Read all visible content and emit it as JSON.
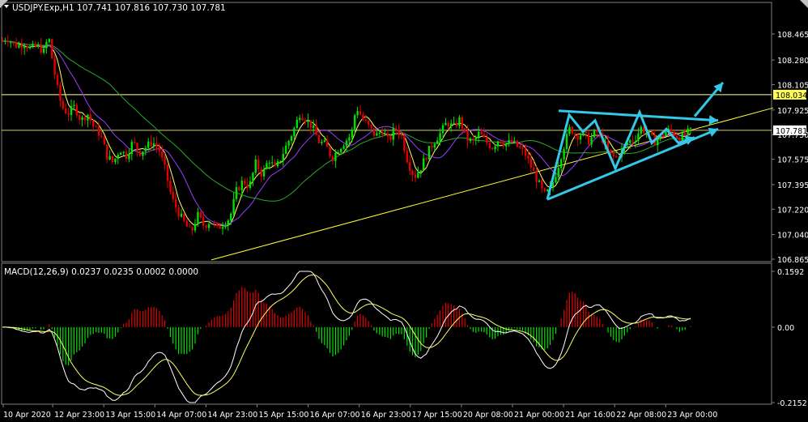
{
  "header": {
    "title": "USDJPY.Exp,H1  107.741 107.816 107.730 107.781",
    "menu_icon": "triangle-down-icon"
  },
  "colors": {
    "background": "#000000",
    "grid": "#6b6b6b",
    "bull": "#00e100",
    "bear": "#e10000",
    "ma_fast": "#ffff66",
    "ma_mid": "#9a3cff",
    "ma_slow": "#2aaa2a",
    "trend": "#ffff33",
    "pattern": "#33c8e6",
    "level_line": "#ffff99",
    "price_tag_bg": "#ffff55",
    "price_tag_current_bg": "#ffffff"
  },
  "price_axis": {
    "ticks": [
      "108.465",
      "108.280",
      "108.105",
      "107.925",
      "107.750",
      "107.575",
      "107.395",
      "107.220",
      "107.040",
      "106.865"
    ],
    "tags": [
      {
        "label": "108.034",
        "value": 108.034,
        "style": "level"
      },
      {
        "label": "107.781",
        "value": 107.781,
        "style": "current"
      }
    ]
  },
  "macd_panel": {
    "title": "MACD(12,26,9) 0.0237 0.0235 0.0002 0.0000",
    "ticks": [
      "0.1592",
      "0.00",
      "-0.2152"
    ]
  },
  "time_axis": {
    "labels": [
      "10 Apr 2020",
      "12 Apr 23:00",
      "13 Apr 15:00",
      "14 Apr 07:00",
      "14 Apr 23:00",
      "15 Apr 15:00",
      "16 Apr 07:00",
      "16 Apr 23:00",
      "17 Apr 15:00",
      "20 Apr 08:00",
      "21 Apr 00:00",
      "21 Apr 16:00",
      "22 Apr 08:00",
      "23 Apr 00:00"
    ]
  },
  "chart_data": {
    "type": "candlestick",
    "symbol": "USDJPY.Exp",
    "timeframe": "H1",
    "ohlc": [
      107.741,
      107.816,
      107.73,
      107.781
    ],
    "ylim": [
      106.865,
      108.58
    ],
    "horizontal_levels": [
      108.034,
      107.781
    ],
    "close_path": [
      [
        0,
        108.4
      ],
      [
        8,
        108.44
      ],
      [
        15,
        108.4
      ],
      [
        22,
        108.38
      ],
      [
        30,
        108.4
      ],
      [
        38,
        108.36
      ],
      [
        46,
        108.38
      ],
      [
        54,
        108.34
      ],
      [
        60,
        108.45
      ],
      [
        64,
        108.3
      ],
      [
        70,
        108.1
      ],
      [
        76,
        107.95
      ],
      [
        84,
        107.9
      ],
      [
        92,
        107.95
      ],
      [
        100,
        107.85
      ],
      [
        108,
        107.9
      ],
      [
        116,
        107.8
      ],
      [
        124,
        107.75
      ],
      [
        132,
        107.6
      ],
      [
        140,
        107.55
      ],
      [
        148,
        107.65
      ],
      [
        156,
        107.6
      ],
      [
        164,
        107.7
      ],
      [
        172,
        107.62
      ],
      [
        180,
        107.66
      ],
      [
        188,
        107.7
      ],
      [
        196,
        107.65
      ],
      [
        204,
        107.5
      ],
      [
        212,
        107.3
      ],
      [
        220,
        107.2
      ],
      [
        228,
        107.12
      ],
      [
        236,
        107.05
      ],
      [
        244,
        107.18
      ],
      [
        252,
        107.1
      ],
      [
        260,
        107.14
      ],
      [
        268,
        107.08
      ],
      [
        276,
        107.12
      ],
      [
        284,
        107.16
      ],
      [
        292,
        107.35
      ],
      [
        300,
        107.42
      ],
      [
        308,
        107.38
      ],
      [
        316,
        107.55
      ],
      [
        324,
        107.46
      ],
      [
        332,
        107.58
      ],
      [
        340,
        107.5
      ],
      [
        348,
        107.6
      ],
      [
        356,
        107.7
      ],
      [
        364,
        107.8
      ],
      [
        370,
        107.9
      ],
      [
        378,
        107.86
      ],
      [
        386,
        107.8
      ],
      [
        394,
        107.7
      ],
      [
        402,
        107.68
      ],
      [
        410,
        107.58
      ],
      [
        418,
        107.65
      ],
      [
        426,
        107.7
      ],
      [
        434,
        107.75
      ],
      [
        440,
        107.95
      ],
      [
        448,
        107.86
      ],
      [
        456,
        107.8
      ],
      [
        464,
        107.74
      ],
      [
        472,
        107.78
      ],
      [
        480,
        107.7
      ],
      [
        488,
        107.8
      ],
      [
        496,
        107.74
      ],
      [
        504,
        107.55
      ],
      [
        512,
        107.45
      ],
      [
        520,
        107.52
      ],
      [
        528,
        107.62
      ],
      [
        536,
        107.7
      ],
      [
        544,
        107.76
      ],
      [
        552,
        107.84
      ],
      [
        560,
        107.8
      ],
      [
        568,
        107.86
      ],
      [
        576,
        107.72
      ],
      [
        584,
        107.7
      ],
      [
        592,
        107.76
      ],
      [
        600,
        107.7
      ],
      [
        608,
        107.66
      ],
      [
        616,
        107.72
      ],
      [
        624,
        107.68
      ],
      [
        632,
        107.7
      ],
      [
        640,
        107.66
      ],
      [
        648,
        107.62
      ],
      [
        656,
        107.52
      ],
      [
        664,
        107.42
      ],
      [
        672,
        107.32
      ],
      [
        680,
        107.36
      ],
      [
        688,
        107.5
      ],
      [
        696,
        107.66
      ],
      [
        704,
        107.8
      ],
      [
        712,
        107.74
      ],
      [
        720,
        107.76
      ],
      [
        728,
        107.7
      ],
      [
        736,
        107.78
      ],
      [
        744,
        107.72
      ],
      [
        752,
        107.62
      ],
      [
        760,
        107.58
      ],
      [
        768,
        107.64
      ],
      [
        776,
        107.7
      ],
      [
        784,
        107.72
      ],
      [
        792,
        107.8
      ],
      [
        800,
        107.76
      ],
      [
        808,
        107.7
      ],
      [
        816,
        107.74
      ],
      [
        824,
        107.78
      ],
      [
        832,
        107.76
      ],
      [
        840,
        107.72
      ],
      [
        848,
        107.76
      ],
      [
        856,
        107.78
      ]
    ],
    "lines": [
      {
        "kind": "trendline",
        "points": [
          [
            261,
            106.86
          ],
          [
            955,
            107.94
          ]
        ],
        "color": "#ffff33"
      },
      {
        "kind": "pattern",
        "points": [
          [
            676,
            107.29
          ],
          [
            703,
            107.89
          ],
          [
            720,
            107.77
          ],
          [
            735,
            107.85
          ],
          [
            760,
            107.51
          ],
          [
            790,
            107.91
          ],
          [
            805,
            107.69
          ],
          [
            823,
            107.79
          ],
          [
            838,
            107.69
          ],
          [
            858,
            107.73
          ]
        ],
        "color": "#33c8e6"
      },
      {
        "kind": "pattern",
        "points": [
          [
            690,
            107.92
          ],
          [
            887,
            107.85
          ]
        ],
        "color": "#33c8e6"
      },
      {
        "kind": "pattern",
        "points": [
          [
            676,
            107.29
          ],
          [
            887,
            107.79
          ]
        ],
        "color": "#33c8e6"
      },
      {
        "kind": "pattern",
        "points": [
          [
            858,
            107.88
          ],
          [
            893,
            108.12
          ]
        ],
        "color": "#33c8e6"
      }
    ],
    "macd": {
      "params": "12,26,9",
      "values": [
        0.0237,
        0.0235,
        0.0002,
        0.0
      ],
      "ylim": [
        -0.2152,
        0.1592
      ]
    }
  }
}
